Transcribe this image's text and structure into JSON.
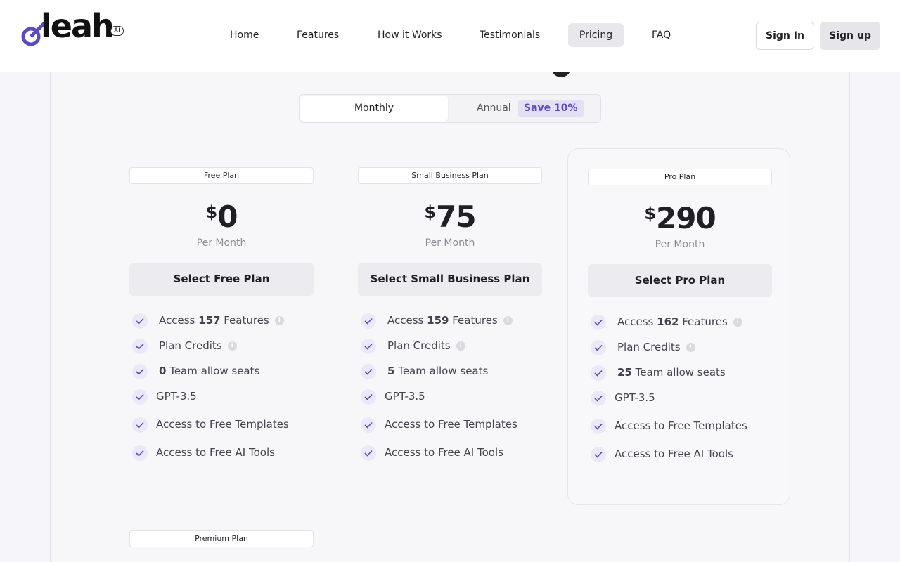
{
  "brand": {
    "logo_text": "leah",
    "badge": "AI",
    "accent": "#5a4bc2"
  },
  "nav": {
    "items": [
      {
        "label": "Home"
      },
      {
        "label": "Features"
      },
      {
        "label": "How it Works"
      },
      {
        "label": "Testimonials"
      },
      {
        "label": "Pricing",
        "active": true
      },
      {
        "label": "FAQ"
      }
    ]
  },
  "auth": {
    "signin_label": "Sign In",
    "signup_label": "Sign up"
  },
  "billing_toggle": {
    "monthly_label": "Monthly",
    "annual_label": "Annual",
    "save_badge": "Save 10%",
    "selected": "Monthly"
  },
  "plans": [
    {
      "tag": "Free Plan",
      "currency": "$",
      "price": "0",
      "period": "Per Month",
      "button": "Select Free Plan",
      "features": {
        "access_prefix": "Access",
        "access_count": "157",
        "access_suffix": "Features",
        "credits": "Plan Credits",
        "seats_count": "0",
        "seats_label": "Team allow seats",
        "model": "GPT-3.5",
        "templates": "Access to Free Templates",
        "tools": "Access to Free AI Tools"
      }
    },
    {
      "tag": "Small Business Plan",
      "currency": "$",
      "price": "75",
      "period": "Per Month",
      "button": "Select Small Business Plan",
      "features": {
        "access_prefix": "Access",
        "access_count": "159",
        "access_suffix": "Features",
        "credits": "Plan Credits",
        "seats_count": "5",
        "seats_label": "Team allow seats",
        "model": "GPT-3.5",
        "templates": "Access to Free Templates",
        "tools": "Access to Free AI Tools"
      }
    },
    {
      "tag": "Pro Plan",
      "currency": "$",
      "price": "290",
      "period": "Per Month",
      "button": "Select Pro Plan",
      "features": {
        "access_prefix": "Access",
        "access_count": "162",
        "access_suffix": "Features",
        "credits": "Plan Credits",
        "seats_count": "25",
        "seats_label": "Team allow seats",
        "model": "GPT-3.5",
        "templates": "Access to Free Templates",
        "tools": "Access to Free AI Tools"
      }
    },
    {
      "tag": "Premium Plan"
    }
  ],
  "icons": {
    "info": "i",
    "check": "check-icon"
  }
}
